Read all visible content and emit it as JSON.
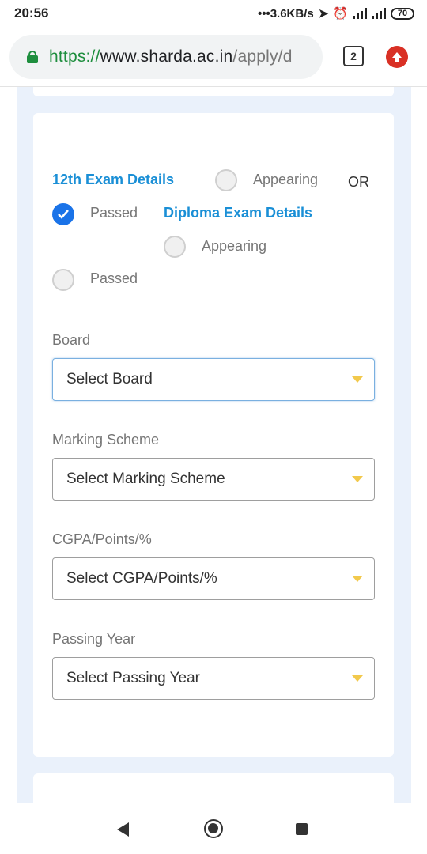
{
  "status_bar": {
    "time": "20:56",
    "network_speed": "3.6KB/s",
    "battery": "70"
  },
  "browser": {
    "url_scheme": "https://",
    "url_host": "www.sharda.ac.in",
    "url_path": "/apply/d",
    "tab_count": "2"
  },
  "exam": {
    "twelfth_title": "12th Exam Details",
    "twelfth_appearing_label": "Appearing",
    "twelfth_appearing_checked": false,
    "or_label": "OR",
    "twelfth_passed_label": "Passed",
    "twelfth_passed_checked": true,
    "diploma_title": "Diploma Exam Details",
    "diploma_appearing_label": "Appearing",
    "diploma_appearing_checked": false,
    "diploma_passed_label": "Passed",
    "diploma_passed_checked": false
  },
  "form": {
    "board_label": "Board",
    "board_value": "Select Board",
    "marking_label": "Marking Scheme",
    "marking_value": "Select Marking Scheme",
    "cgpa_label": "CGPA/Points/%",
    "cgpa_value": "Select CGPA/Points/%",
    "year_label": "Passing Year",
    "year_value": "Select Passing Year"
  },
  "colors": {
    "accent": "#1a8fd6",
    "radio_checked": "#1a73e8",
    "secure_green": "#1e8e3e",
    "page_background": "#eaf1fb",
    "dropdown_caret": "#f2c94c"
  }
}
